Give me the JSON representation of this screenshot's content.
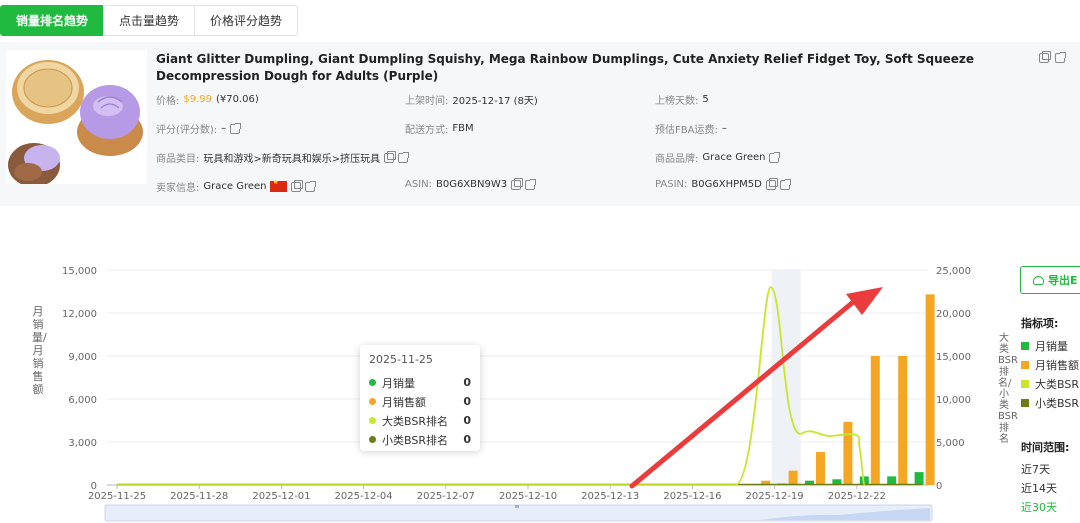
{
  "tabs": [
    {
      "label": "销量排名趋势",
      "active": true
    },
    {
      "label": "点击量趋势",
      "active": false
    },
    {
      "label": "价格评分趋势",
      "active": false
    }
  ],
  "product": {
    "title": "Giant Glitter Dumpling, Giant Dumpling Squishy, Mega Rainbow Dumplings, Cute Anxiety Relief Fidget Toy, Soft Squeeze Decompression Dough for Adults (Purple)",
    "price_label": "价格:",
    "price": "$9.99",
    "price_cny": "(¥70.06)",
    "listing_time_label": "上架时间:",
    "listing_time": "2025-12-17 (8天)",
    "days_on_list_label": "上榜天数:",
    "days_on_list": "5",
    "rating_label": "评分(评分数):",
    "rating": "–",
    "shipping_label": "配送方式:",
    "shipping": "FBM",
    "fba_label": "预估FBA运费:",
    "fba": "–",
    "category_label": "商品类目:",
    "category": "玩具和游戏>新奇玩具和娱乐>挤压玩具",
    "brand_label": "商品品牌:",
    "brand": "Grace Green",
    "seller_label": "卖家信息:",
    "seller": "Grace Green",
    "asin_label": "ASIN:",
    "asin": "B0G6XBN9W3",
    "pasin_label": "PASIN:",
    "pasin": "B0G6XHPM5D"
  },
  "chart": {
    "left_axis_label": "月销量/月销售额",
    "right_axis_label": "大类BSR排名/小类BSR排名",
    "tooltip": {
      "date": "2025-11-25",
      "rows": [
        {
          "name": "月销量",
          "value": "0",
          "color": "#1fba3f"
        },
        {
          "name": "月销售额",
          "value": "0",
          "color": "#f5a623"
        },
        {
          "name": "大类BSR排名",
          "value": "0",
          "color": "#c8e62a"
        },
        {
          "name": "小类BSR排名",
          "value": "0",
          "color": "#6b7d16"
        }
      ]
    }
  },
  "chart_data": {
    "type": "bar",
    "x_tick_labels": [
      "2025-11-25",
      "2025-11-28",
      "2025-12-01",
      "2025-12-04",
      "2025-12-07",
      "2025-12-10",
      "2025-12-13",
      "2025-12-16",
      "2025-12-19",
      "2025-12-22"
    ],
    "left_ticks": [
      "0",
      "3,000",
      "6,000",
      "9,000",
      "12,000",
      "15,000"
    ],
    "right_ticks": [
      "0",
      "5,000",
      "10,000",
      "15,000",
      "20,000",
      "25,000"
    ],
    "ylim_left": [
      0,
      15000
    ],
    "ylim_right": [
      0,
      25000
    ],
    "dates": [
      "2025-12-18",
      "2025-12-19",
      "2025-12-20",
      "2025-12-21",
      "2025-12-22",
      "2025-12-23",
      "2025-12-24"
    ],
    "series": [
      {
        "name": "月销量",
        "color": "#1fba3f",
        "axis": "left",
        "values": [
          30,
          100,
          300,
          400,
          600,
          600,
          900
        ]
      },
      {
        "name": "月销售额",
        "color": "#f5a623",
        "axis": "left",
        "values": [
          300,
          1000,
          2300,
          4400,
          9000,
          9000,
          13300
        ]
      },
      {
        "name": "大类BSR排名",
        "color": "#c8e62a",
        "axis": "right",
        "points": [
          [
            "2025-12-18",
            0
          ],
          [
            "2025-12-19",
            23000
          ],
          [
            "2025-12-20",
            6000
          ],
          [
            "2025-12-21",
            5700
          ],
          [
            "2025-12-22",
            5600
          ],
          [
            "2025-12-22",
            0
          ]
        ]
      },
      {
        "name": "小类BSR排名",
        "color": "#6b7d16",
        "axis": "right",
        "values": [
          0,
          0,
          0,
          0,
          0,
          0,
          0
        ]
      }
    ]
  },
  "legend": {
    "export_label": "导出E",
    "indicator_title": "指标项:",
    "items": [
      {
        "label": "月销量",
        "color": "#1fba3f"
      },
      {
        "label": "月销售额",
        "color": "#f5a623"
      },
      {
        "label": "大类BSR",
        "color": "#c8e62a"
      },
      {
        "label": "小类BSR",
        "color": "#6b7d16"
      }
    ],
    "range_title": "时间范围:",
    "ranges": [
      {
        "label": "近7天",
        "active": false
      },
      {
        "label": "近14天",
        "active": false
      },
      {
        "label": "近30天",
        "active": true
      }
    ]
  }
}
